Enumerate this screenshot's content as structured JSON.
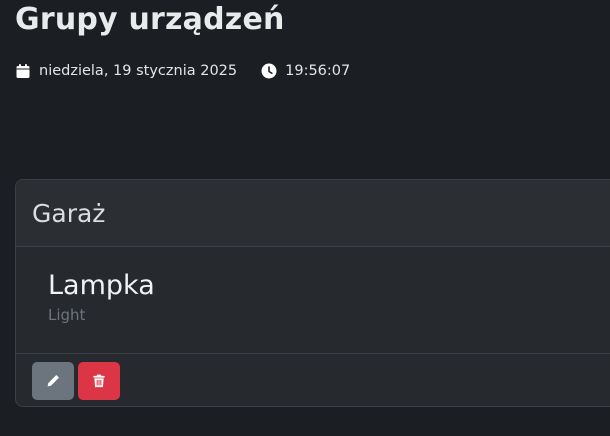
{
  "header": {
    "title": "Grupy urządzeń",
    "date": "niedziela, 19 stycznia 2025",
    "time": "19:56:07",
    "date_icon": "calendar-icon",
    "time_icon": "clock-icon"
  },
  "group": {
    "name": "Garaż",
    "devices": [
      {
        "name": "Lampka",
        "type": "Light"
      }
    ],
    "actions": {
      "edit_icon": "pencil-icon",
      "delete_icon": "trash-icon",
      "edit_color": "#6c757d",
      "delete_color": "#dc3545"
    }
  }
}
